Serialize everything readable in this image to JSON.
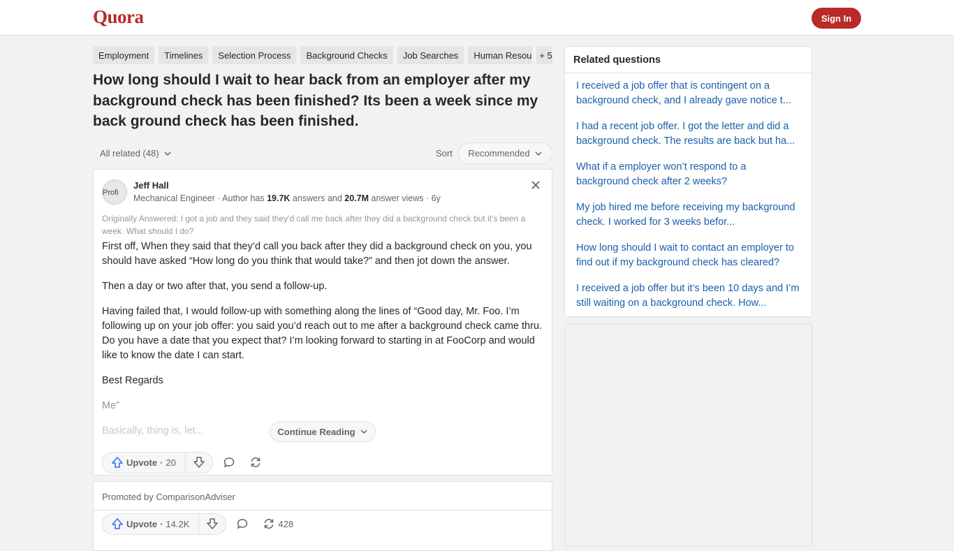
{
  "header": {
    "logo": "Quora",
    "signin_label": "Sign In"
  },
  "topics": [
    "Employment",
    "Timelines",
    "Selection Process",
    "Background Checks",
    "Job Searches",
    "Human Resou",
    "+ 5"
  ],
  "question": {
    "title": "How long should I wait to hear back from an employer after my background check has been finished? Its been a week since my back ground check has been finished."
  },
  "filters": {
    "all_related": "All related (48)",
    "sort_label": "Sort",
    "sort_value": "Recommended"
  },
  "answer": {
    "avatar_alt": "Profi",
    "author": "Jeff Hall",
    "cred_prefix": "Mechanical Engineer · Author has ",
    "answers_count": "19.7K",
    "cred_mid": " answers and ",
    "views_count": "20.7M",
    "cred_suffix": " answer views · 6y",
    "originally_answered": "Originally Answered: I got a job and they said they'd call me back after they did a background check but it's been a week. What should I do?",
    "paragraphs": [
      "First off, When they said that they’d call you back after they did a background check on you, you should have asked “How long do you think that would take?” and then jot down the answer.",
      "Then a day or two after that, you send a follow-up.",
      "Having failed that, I would follow-up with something along the lines of “Good day, Mr. Foo. I’m following up on your job offer: you said you’d reach out to me after a background check came thru. Do you have a date that you expect that? I’m looking forward to starting in at FooCorp and would like to know the date I can start.",
      "Best Regards",
      "Me”",
      "Basically, thing is, let..."
    ],
    "continue_label": "Continue Reading",
    "upvote_label": "Upvote",
    "upvote_count": "20"
  },
  "promoted": {
    "label": "Promoted by ComparisonAdviser",
    "upvote_label": "Upvote",
    "upvote_count": "14.2K",
    "share_count": "428"
  },
  "related": {
    "title": "Related questions",
    "items": [
      "I received a job offer that is contingent on a background check, and I already gave notice t...",
      "I had a recent job offer. I got the letter and did a background check. The results are back but ha...",
      "What if a employer won’t respond to a background check after 2 weeks?",
      "My job hired me before receiving my background check. I worked for 3 weeks befor...",
      "How long should I wait to contact an employer to find out if my background check has cleared?",
      "I received a job offer but it’s been 10 days and I’m still waiting on a background check. How..."
    ]
  },
  "colors": {
    "brand": "#b92b27",
    "link": "#195faa"
  }
}
